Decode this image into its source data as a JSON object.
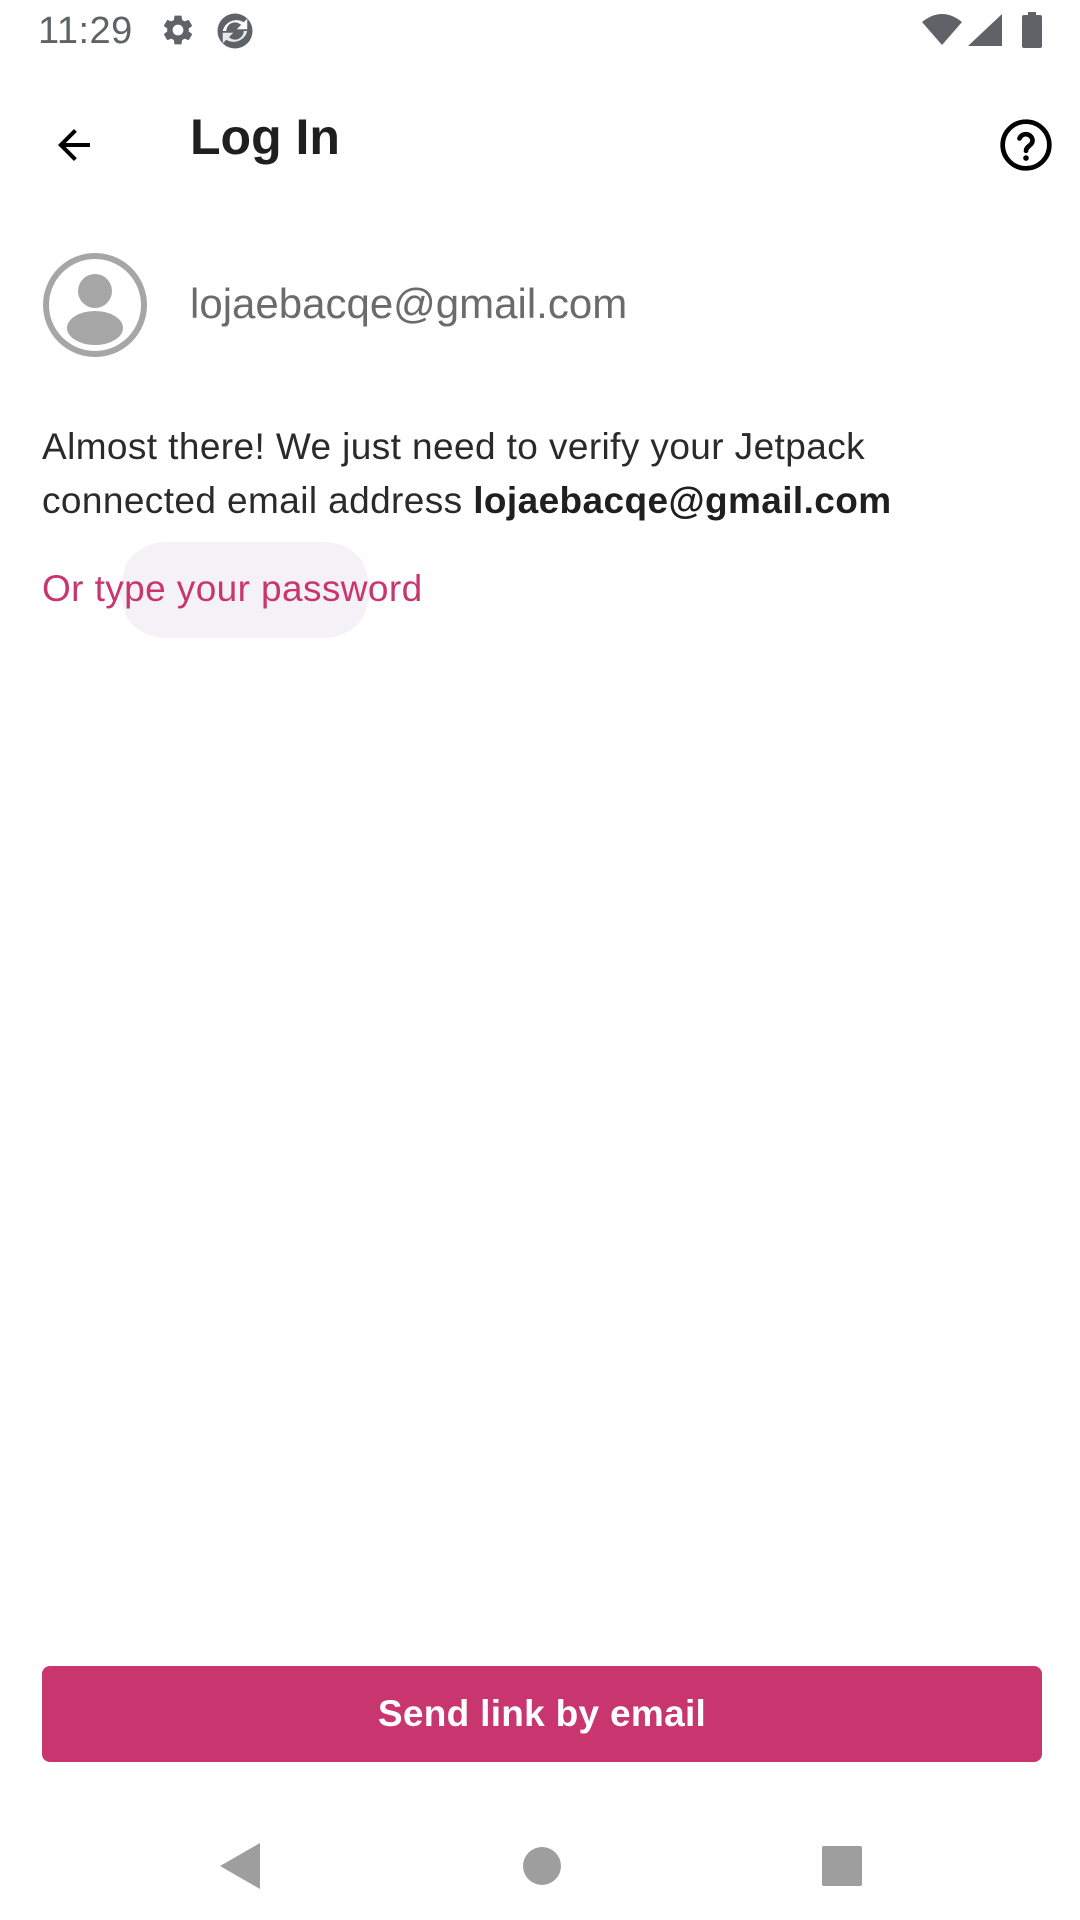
{
  "status_bar": {
    "time": "11:29",
    "icons": [
      "gear-icon",
      "sync-icon",
      "wifi-icon",
      "cellular-signal-icon",
      "battery-icon"
    ]
  },
  "app_bar": {
    "title": "Log In",
    "back_icon": "arrow-back-icon",
    "help_icon": "help-circle-icon"
  },
  "account": {
    "avatar_icon": "account-circle-icon",
    "email": "lojaebacqe@gmail.com"
  },
  "message": {
    "text": "Almost there! We just need to verify your Jetpack connected email address ",
    "email": "lojaebacqe@gmail.com"
  },
  "password_link": {
    "label": "Or type your password"
  },
  "primary_button": {
    "label": "Send link by email"
  },
  "colors": {
    "accent": "#c9356e",
    "text_primary": "#1f1f1f",
    "text_secondary": "#6b6b6b",
    "avatar_gray": "#a6a6a6",
    "ripple": "#f4f2f7"
  },
  "nav_bar": {
    "icons": [
      "nav-back-icon",
      "nav-home-icon",
      "nav-recents-icon"
    ]
  }
}
